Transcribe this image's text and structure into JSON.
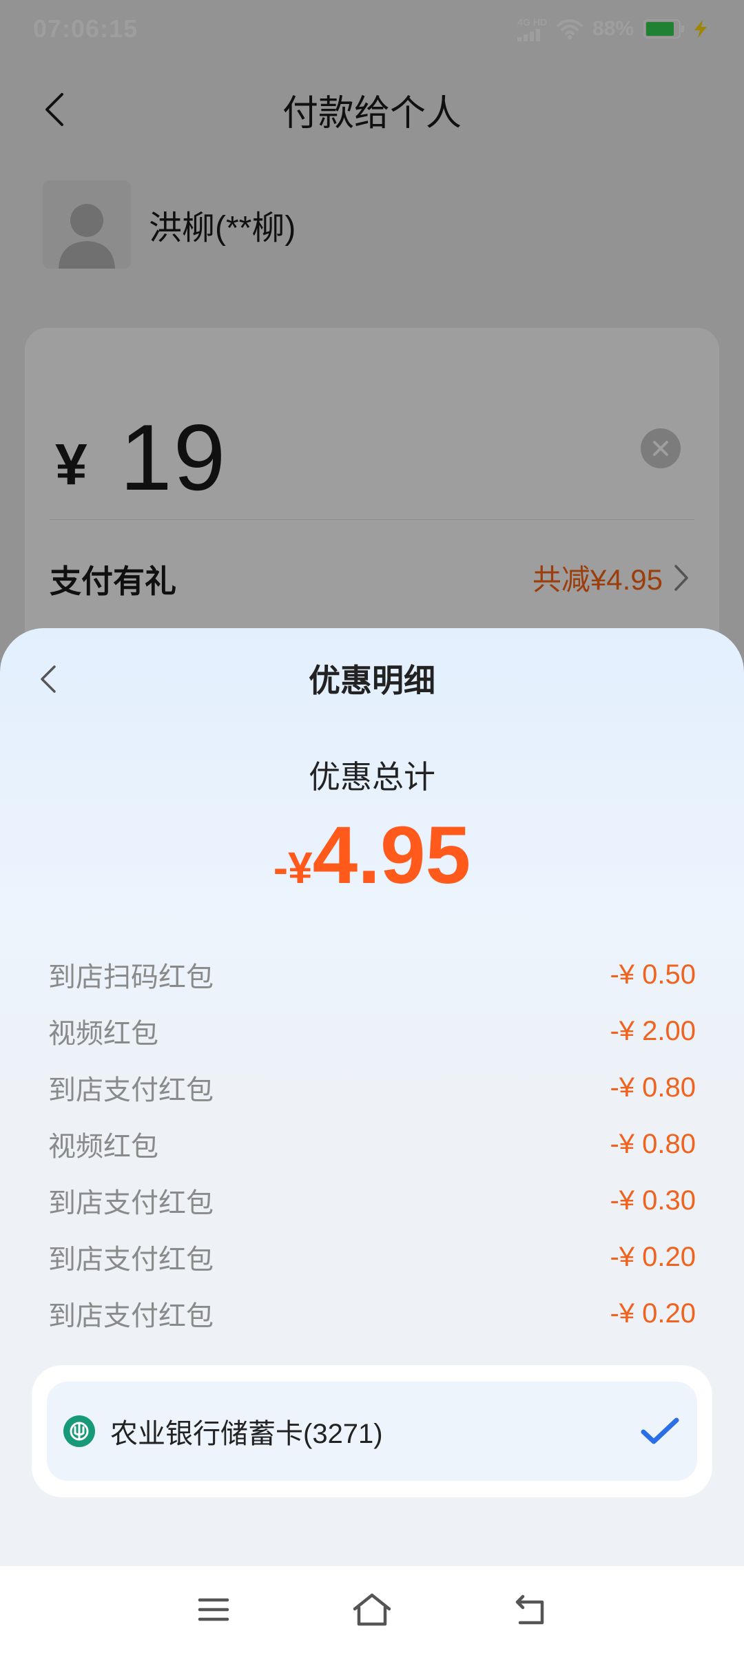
{
  "status_bar": {
    "time": "07:06:15",
    "network_label": "4G HD",
    "battery_percent": "88%",
    "battery_level": 0.88,
    "battery_color": "#33d04f"
  },
  "header": {
    "title": "付款给个人",
    "back_icon": "chevron-left-icon"
  },
  "payee": {
    "name": "洪柳(**柳)",
    "avatar_icon": "person-silhouette-icon"
  },
  "amount_card": {
    "currency_symbol": "¥",
    "amount": "19",
    "clear_icon": "clear-circle-icon",
    "gift_label": "支付有礼",
    "gift_summary": "共减¥4.95",
    "gift_chevron_icon": "chevron-right-icon"
  },
  "discount_sheet": {
    "title": "优惠明细",
    "back_icon": "chevron-left-icon",
    "total_label": "优惠总计",
    "total_prefix": "-¥",
    "total_value": "4.95",
    "items": [
      {
        "name": "到店扫码红包",
        "amount": "-¥ 0.50"
      },
      {
        "name": "视频红包",
        "amount": "-¥ 2.00"
      },
      {
        "name": "到店支付红包",
        "amount": "-¥ 0.80"
      },
      {
        "name": "视频红包",
        "amount": "-¥ 0.80"
      },
      {
        "name": "到店支付红包",
        "amount": "-¥ 0.30"
      },
      {
        "name": "到店支付红包",
        "amount": "-¥ 0.20"
      },
      {
        "name": "到店支付红包",
        "amount": "-¥ 0.20"
      }
    ],
    "payment_method": {
      "label": "农业银行储蓄卡(3271)",
      "bank_icon": "abc-bank-logo-icon",
      "selected_icon": "checkmark-icon",
      "selected": true
    }
  },
  "colors": {
    "accent_orange": "#ff5a1c",
    "check_blue": "#2a6fe6",
    "bank_green": "#17997a"
  },
  "nav_bar": {
    "menu_icon": "menu-icon",
    "home_icon": "home-icon",
    "back_icon": "back-arrow-icon"
  }
}
